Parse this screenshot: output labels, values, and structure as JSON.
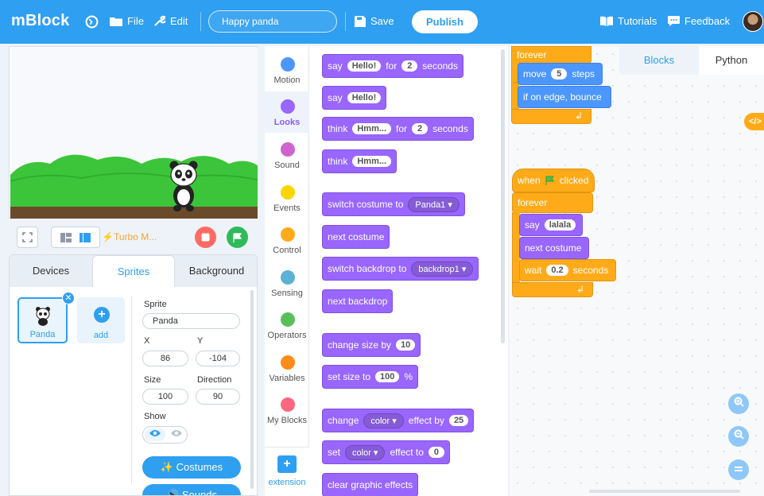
{
  "app": {
    "name": "mBlock"
  },
  "topbar": {
    "file_label": "File",
    "edit_label": "Edit",
    "project_name": "Happy panda",
    "save_label": "Save",
    "publish_label": "Publish",
    "tutorials_label": "Tutorials",
    "feedback_label": "Feedback",
    "color": "#2f9ff1"
  },
  "stage_controls": {
    "turbo_label": "Turbo M..."
  },
  "sprite_panel": {
    "tabs": [
      "Devices",
      "Sprites",
      "Background"
    ],
    "active_tab": "Sprites",
    "sprite_thumb_name": "Panda",
    "add_label": "add",
    "sprite_label": "Sprite",
    "sprite_name": "Panda",
    "x_label": "X",
    "y_label": "Y",
    "x": "86",
    "y": "-104",
    "size_label": "Size",
    "direction_label": "Direction",
    "size": "100",
    "direction": "90",
    "show_label": "Show",
    "costumes_label": "Costumes",
    "sounds_label": "Sounds"
  },
  "categories": [
    {
      "label": "Motion",
      "color": "#4c97ff"
    },
    {
      "label": "Looks",
      "color": "#9966ff"
    },
    {
      "label": "Sound",
      "color": "#cf63cf"
    },
    {
      "label": "Events",
      "color": "#ffd500"
    },
    {
      "label": "Control",
      "color": "#ffab19"
    },
    {
      "label": "Sensing",
      "color": "#5cb1d6"
    },
    {
      "label": "Operators",
      "color": "#59c059"
    },
    {
      "label": "Variables",
      "color": "#ff8c1a"
    },
    {
      "label": "My Blocks",
      "color": "#ff6680"
    }
  ],
  "active_category": "Looks",
  "extension_label": "extension",
  "palette": {
    "say_for": {
      "word": "say",
      "arg": "Hello!",
      "for": "for",
      "secs": "2",
      "unit": "seconds"
    },
    "say": {
      "word": "say",
      "arg": "Hello!"
    },
    "think_for": {
      "word": "think",
      "arg": "Hmm...",
      "for": "for",
      "secs": "2",
      "unit": "seconds"
    },
    "think": {
      "word": "think",
      "arg": "Hmm..."
    },
    "switch_costume": {
      "text": "switch costume to",
      "value": "Panda1"
    },
    "next_costume": "next costume",
    "switch_backdrop": {
      "text": "switch backdrop to",
      "value": "backdrop1"
    },
    "next_backdrop": "next backdrop",
    "change_size": {
      "text": "change size by",
      "value": "10"
    },
    "set_size": {
      "text": "set size to",
      "value": "100",
      "unit": "%"
    },
    "change_effect": {
      "word": "change",
      "effect": "color",
      "by": "effect by",
      "value": "25"
    },
    "set_effect": {
      "word": "set",
      "effect": "color",
      "to": "effect to",
      "value": "0"
    },
    "clear_effects": "clear graphic effects"
  },
  "code_tabs": [
    "Blocks",
    "Python"
  ],
  "active_code_tab": "Blocks",
  "script1": {
    "forever": "forever",
    "move": "move",
    "move_value": "5",
    "steps": "steps",
    "bounce": "if on edge, bounce"
  },
  "script2": {
    "when": "when",
    "clicked": "clicked",
    "forever": "forever",
    "say": "say",
    "say_value": "lalala",
    "next_costume": "next costume",
    "wait": "wait",
    "wait_value": "0.2",
    "seconds": "seconds"
  }
}
